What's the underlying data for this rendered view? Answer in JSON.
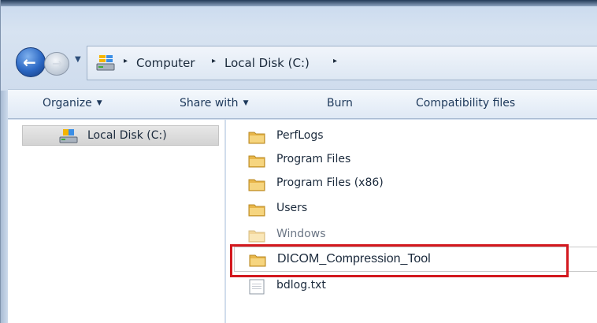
{
  "window": {
    "frame_color": "#cfdced",
    "accent_color": "#2b67c3"
  },
  "navigation": {
    "back_icon": "back-arrow-icon",
    "forward_icon": "forward-arrow-icon",
    "back_glyph": "←",
    "forward_glyph": "→",
    "dropdown_glyph": "▼",
    "address_icon": "computer-drive-icon",
    "separator_glyph": "▸",
    "breadcrumbs": [
      "Computer",
      "Local Disk (C:)"
    ]
  },
  "toolbar": {
    "items": [
      {
        "label": "Organize",
        "has_dropdown": true
      },
      {
        "label": "Share with",
        "has_dropdown": true
      },
      {
        "label": "Burn",
        "has_dropdown": false
      },
      {
        "label": "Compatibility files",
        "has_dropdown": false
      }
    ],
    "caret_glyph": "▼"
  },
  "nav_pane": {
    "items": [
      {
        "label": "Local Disk (C:)",
        "icon": "local-disk-icon",
        "selected": true
      }
    ]
  },
  "file_list": {
    "items": [
      {
        "label": "PerfLogs",
        "icon": "folder-icon",
        "state": "normal"
      },
      {
        "label": "Program Files",
        "icon": "folder-icon",
        "state": "normal"
      },
      {
        "label": "Program Files (x86)",
        "icon": "folder-icon",
        "state": "normal"
      },
      {
        "label": "Users",
        "icon": "folder-icon",
        "state": "normal"
      },
      {
        "label": "Windows",
        "icon": "folder-icon",
        "state": "faded"
      },
      {
        "label": "DICOM_Compression_Tool",
        "icon": "folder-icon",
        "state": "highlighted"
      },
      {
        "label": "bdlog.txt",
        "icon": "text-file-icon",
        "state": "normal"
      }
    ],
    "highlight_color": "#d3181e"
  }
}
